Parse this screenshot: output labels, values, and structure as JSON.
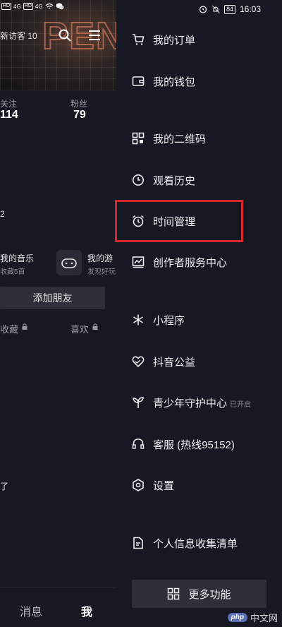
{
  "status_bar": {
    "left_indicators": [
      "HD",
      "HD",
      "4G",
      "4G"
    ],
    "battery": "84",
    "time": "16:03"
  },
  "profile_bg": {
    "visitor_text": "新访客 10",
    "following_label": "关注",
    "following_count": "114",
    "fans_label": "粉丝",
    "fans_count": "79",
    "fragment_text": "2",
    "music_title": "我的音乐",
    "music_sub": "收藏5首",
    "game_title": "我的游",
    "game_sub": "发现好玩",
    "add_friend": "添加朋友",
    "tab_favorites": "收藏",
    "tab_likes": "喜欢",
    "fragment_text2": "了",
    "nav_messages": "消息",
    "nav_me": "我"
  },
  "drawer": {
    "items": [
      {
        "label": "我的订单",
        "icon": "cart-icon"
      },
      {
        "label": "我的钱包",
        "icon": "wallet-icon"
      },
      {
        "label": "我的二维码",
        "icon": "qrcode-icon"
      },
      {
        "label": "观看历史",
        "icon": "history-clock-icon"
      },
      {
        "label": "时间管理",
        "icon": "alarm-clock-icon"
      },
      {
        "label": "创作者服务中心",
        "icon": "chart-icon"
      },
      {
        "label": "小程序",
        "icon": "asterisk-icon"
      },
      {
        "label": "抖音公益",
        "icon": "charity-heart-icon"
      },
      {
        "label": "青少年守护中心",
        "icon": "sprout-icon",
        "badge": "已开启"
      },
      {
        "label": "客服 (热线95152)",
        "icon": "headset-icon"
      },
      {
        "label": "设置",
        "icon": "hexagon-settings-icon"
      },
      {
        "label": "个人信息收集清单",
        "icon": "document-icon"
      }
    ],
    "more_button": "更多功能",
    "highlight_color": "#d7262c"
  },
  "watermark": {
    "badge": "php",
    "text": "中文网"
  }
}
